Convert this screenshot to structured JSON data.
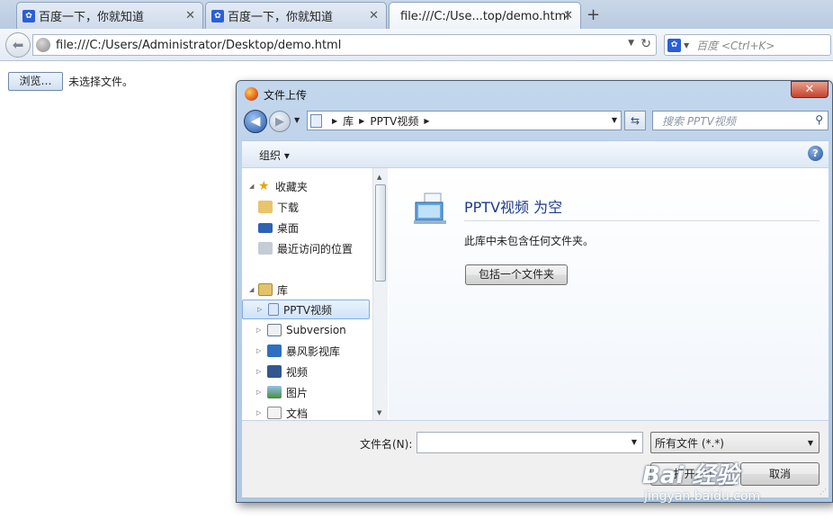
{
  "browser": {
    "tabs": [
      {
        "label": "百度一下，你就知道",
        "favicon": "baidu-paw-icon"
      },
      {
        "label": "百度一下，你就知道",
        "favicon": "baidu-paw-icon"
      },
      {
        "label": "file:///C:/Use...top/demo.html",
        "favicon": ""
      }
    ],
    "url": "file:///C:/Users/Administrator/Desktop/demo.html",
    "search_placeholder": "百度 <Ctrl+K>"
  },
  "page": {
    "browse_button": "浏览…",
    "no_file_text": "未选择文件。"
  },
  "dialog": {
    "title": "文件上传",
    "breadcrumb": [
      "库",
      "PPTV视频"
    ],
    "search_placeholder": "搜索 PPTV视频",
    "organize_label": "组织 ▾",
    "tree": {
      "favorites": {
        "label": "收藏夹",
        "items": [
          "下载",
          "桌面",
          "最近访问的位置"
        ]
      },
      "libraries": {
        "label": "库",
        "items": [
          "PPTV视频",
          "Subversion",
          "暴风影视库",
          "视频",
          "图片",
          "文档"
        ]
      }
    },
    "empty": {
      "title": "PPTV视频 为空",
      "description": "此库中未包含任何文件夹。",
      "include_button": "包括一个文件夹"
    },
    "footer": {
      "filename_label": "文件名(N):",
      "filename_value": "",
      "filetype": "所有文件 (*.*)",
      "open_button": "打开(O)",
      "cancel_button": "取消"
    }
  },
  "watermark": {
    "logo": "Bai 经验",
    "url": "jingyan.baidu.com"
  },
  "colors": {
    "accent": "#2a5fd6",
    "dialog_frame": "#aec7e2",
    "title_blue": "#1e3c8c"
  }
}
